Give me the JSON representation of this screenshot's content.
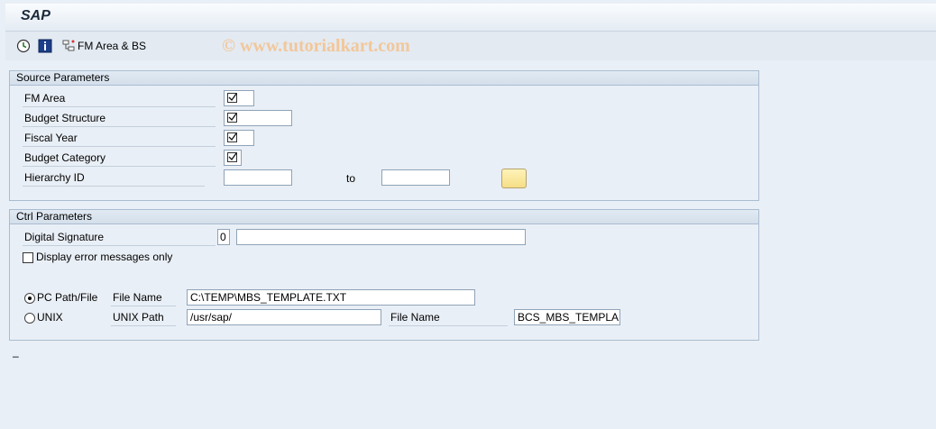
{
  "title": "SAP",
  "toolbar": {
    "execute_icon": "execute-clock-icon",
    "info_icon": "information-icon",
    "fm_button_label": "FM Area & BS"
  },
  "watermark": "© www.tutorialkart.com",
  "source": {
    "header": "Source Parameters",
    "fm_area": "FM Area",
    "budget_structure": "Budget Structure",
    "fiscal_year": "Fiscal Year",
    "budget_category": "Budget Category",
    "hierarchy_id": "Hierarchy ID",
    "to_label": "to"
  },
  "ctrl": {
    "header": "Ctrl Parameters",
    "digital_signature": "Digital Signature",
    "digital_signature_value": "0",
    "display_errors": "Display error messages only",
    "pc_path_label": "PC Path/File",
    "file_name_label": "File Name",
    "file_name_value": "C:\\TEMP\\MBS_TEMPLATE.TXT",
    "unix_label": "UNIX",
    "unix_path_label": "UNIX Path",
    "unix_path_value": "/usr/sap/",
    "unix_file_name_label": "File Name",
    "unix_file_name_value": "BCS_MBS_TEMPLA..."
  },
  "status_text": "–",
  "colors": {
    "accent_yellow": "#f5de86",
    "group_border": "#a9bdd1",
    "background": "#e9eff6"
  }
}
